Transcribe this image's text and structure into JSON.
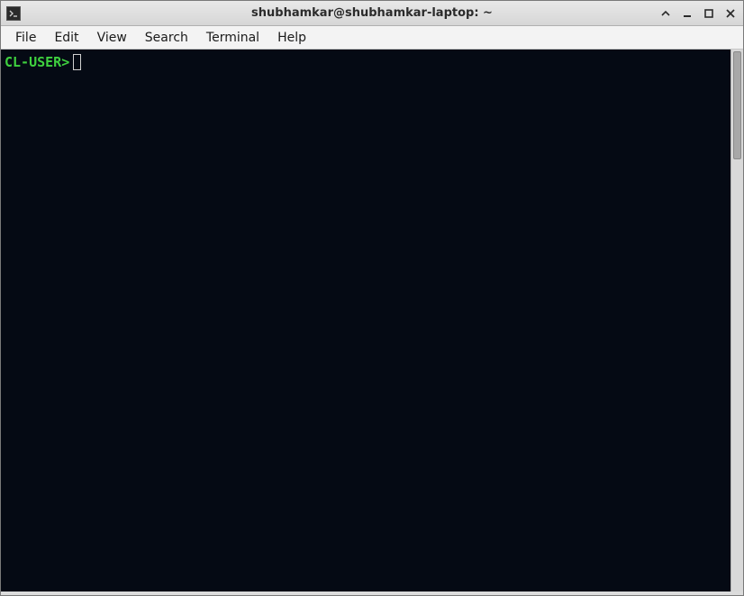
{
  "window": {
    "title": "shubhamkar@shubhamkar-laptop: ~"
  },
  "menubar": {
    "items": [
      "File",
      "Edit",
      "View",
      "Search",
      "Terminal",
      "Help"
    ]
  },
  "terminal": {
    "prompt": "CL-USER>",
    "input": ""
  }
}
